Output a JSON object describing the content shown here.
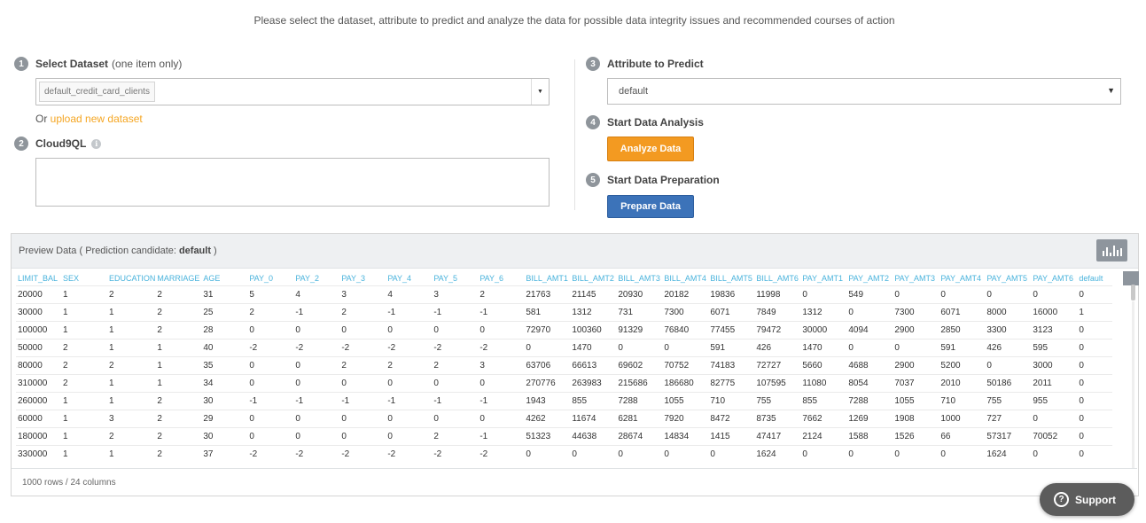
{
  "intro": "Please select the dataset, attribute to predict and analyze the data for possible data integrity issues and recommended courses of action",
  "steps": {
    "select_dataset": {
      "num": "1",
      "label": "Select Dataset",
      "sub": "(one item only)",
      "value": "default_credit_card_clients"
    },
    "upload": {
      "prefix": "Or ",
      "link": "upload new dataset"
    },
    "cloud9ql": {
      "num": "2",
      "label": "Cloud9QL",
      "info": "i"
    },
    "attribute": {
      "num": "3",
      "label": "Attribute to Predict",
      "value": "default"
    },
    "analysis": {
      "num": "4",
      "label": "Start Data Analysis",
      "button": "Analyze Data"
    },
    "preparation": {
      "num": "5",
      "label": "Start Data Preparation",
      "button": "Prepare Data"
    }
  },
  "preview": {
    "title_prefix": "Preview Data ( Prediction candidate:",
    "candidate": "default",
    "title_suffix": ")",
    "columns": [
      "LIMIT_BAL",
      "SEX",
      "EDUCATION",
      "MARRIAGE",
      "AGE",
      "PAY_0",
      "PAY_2",
      "PAY_3",
      "PAY_4",
      "PAY_5",
      "PAY_6",
      "BILL_AMT1",
      "BILL_AMT2",
      "BILL_AMT3",
      "BILL_AMT4",
      "BILL_AMT5",
      "BILL_AMT6",
      "PAY_AMT1",
      "PAY_AMT2",
      "PAY_AMT3",
      "PAY_AMT4",
      "PAY_AMT5",
      "PAY_AMT6",
      "default"
    ],
    "rows": [
      [
        "20000",
        "1",
        "2",
        "2",
        "31",
        "5",
        "4",
        "3",
        "4",
        "3",
        "2",
        "21763",
        "21145",
        "20930",
        "20182",
        "19836",
        "11998",
        "0",
        "549",
        "0",
        "0",
        "0",
        "0",
        "0"
      ],
      [
        "30000",
        "1",
        "1",
        "2",
        "25",
        "2",
        "-1",
        "2",
        "-1",
        "-1",
        "-1",
        "581",
        "1312",
        "731",
        "7300",
        "6071",
        "7849",
        "1312",
        "0",
        "7300",
        "6071",
        "8000",
        "16000",
        "1"
      ],
      [
        "100000",
        "1",
        "1",
        "2",
        "28",
        "0",
        "0",
        "0",
        "0",
        "0",
        "0",
        "72970",
        "100360",
        "91329",
        "76840",
        "77455",
        "79472",
        "30000",
        "4094",
        "2900",
        "2850",
        "3300",
        "3123",
        "0"
      ],
      [
        "50000",
        "2",
        "1",
        "1",
        "40",
        "-2",
        "-2",
        "-2",
        "-2",
        "-2",
        "-2",
        "0",
        "1470",
        "0",
        "0",
        "591",
        "426",
        "1470",
        "0",
        "0",
        "591",
        "426",
        "595",
        "0"
      ],
      [
        "80000",
        "2",
        "2",
        "1",
        "35",
        "0",
        "0",
        "2",
        "2",
        "2",
        "3",
        "63706",
        "66613",
        "69602",
        "70752",
        "74183",
        "72727",
        "5660",
        "4688",
        "2900",
        "5200",
        "0",
        "3000",
        "0"
      ],
      [
        "310000",
        "2",
        "1",
        "1",
        "34",
        "0",
        "0",
        "0",
        "0",
        "0",
        "0",
        "270776",
        "263983",
        "215686",
        "186680",
        "82775",
        "107595",
        "11080",
        "8054",
        "7037",
        "2010",
        "50186",
        "2011",
        "0"
      ],
      [
        "260000",
        "1",
        "1",
        "2",
        "30",
        "-1",
        "-1",
        "-1",
        "-1",
        "-1",
        "-1",
        "1943",
        "855",
        "7288",
        "1055",
        "710",
        "755",
        "855",
        "7288",
        "1055",
        "710",
        "755",
        "955",
        "0"
      ],
      [
        "60000",
        "1",
        "3",
        "2",
        "29",
        "0",
        "0",
        "0",
        "0",
        "0",
        "0",
        "4262",
        "11674",
        "6281",
        "7920",
        "8472",
        "8735",
        "7662",
        "1269",
        "1908",
        "1000",
        "727",
        "0",
        "0"
      ],
      [
        "180000",
        "1",
        "2",
        "2",
        "30",
        "0",
        "0",
        "0",
        "0",
        "2",
        "-1",
        "51323",
        "44638",
        "28674",
        "14834",
        "1415",
        "47417",
        "2124",
        "1588",
        "1526",
        "66",
        "57317",
        "70052",
        "0"
      ],
      [
        "330000",
        "1",
        "1",
        "2",
        "37",
        "-2",
        "-2",
        "-2",
        "-2",
        "-2",
        "-2",
        "0",
        "0",
        "0",
        "0",
        "0",
        "1624",
        "0",
        "0",
        "0",
        "0",
        "1624",
        "0",
        "0"
      ]
    ],
    "footer": "1000 rows / 24 columns"
  },
  "support": {
    "label": "Support",
    "icon": "?"
  },
  "colors": {
    "accent_orange": "#f39a21",
    "accent_blue": "#3c73b9",
    "link": "#f5a623",
    "header_text": "#49b3dc"
  }
}
